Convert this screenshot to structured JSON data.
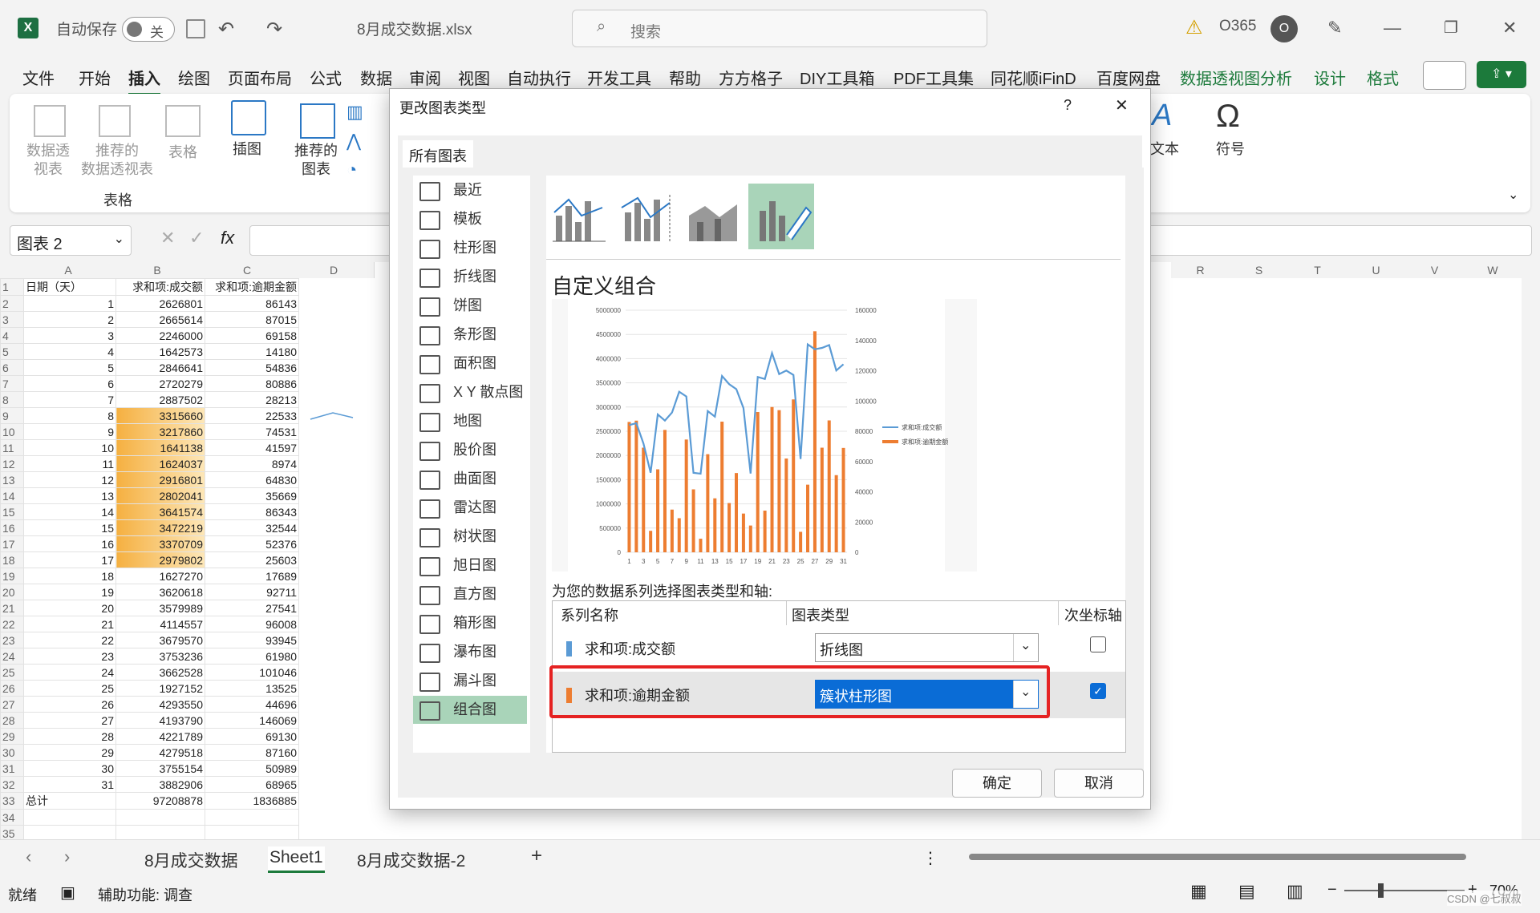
{
  "titlebar": {
    "autosave": "自动保存",
    "toggle": "关",
    "filename": "8月成交数据.xlsx",
    "search": "搜索",
    "account": "O365",
    "avatar": "O"
  },
  "menu": [
    "文件",
    "开始",
    "插入",
    "绘图",
    "页面布局",
    "公式",
    "数据",
    "审阅",
    "视图",
    "自动执行",
    "开发工具",
    "帮助",
    "方方格子",
    "DIY工具箱",
    "PDF工具集",
    "同花顺iFinD",
    "百度网盘",
    "数据透视图分析",
    "设计",
    "格式"
  ],
  "ribbon": {
    "pivot": "数据透\n视表",
    "rec_pivot": "推荐的\n数据透视表",
    "table": "表格",
    "group_table": "表格",
    "illustrations": "插图",
    "rec_charts": "推荐的\n图表",
    "text": "文本",
    "symbol": "符号"
  },
  "formula": {
    "namebox": "图表 2",
    "fx": "fx"
  },
  "sheet": {
    "cols_left": [
      "A",
      "B",
      "C",
      "D"
    ],
    "cols_right": [
      "R",
      "S",
      "T",
      "U",
      "V",
      "W"
    ],
    "header": [
      "日期（天）",
      "求和项:成交额",
      "求和项:逾期金额"
    ],
    "rows": [
      [
        1,
        2626801,
        86143
      ],
      [
        2,
        2665614,
        87015
      ],
      [
        3,
        2246000,
        69158
      ],
      [
        4,
        1642573,
        14180
      ],
      [
        5,
        2846641,
        54836
      ],
      [
        6,
        2720279,
        80886
      ],
      [
        7,
        2887502,
        28213
      ],
      [
        8,
        3315660,
        22533
      ],
      [
        9,
        3217860,
        74531
      ],
      [
        10,
        1641138,
        41597
      ],
      [
        11,
        1624037,
        8974
      ],
      [
        12,
        2916801,
        64830
      ],
      [
        13,
        2802041,
        35669
      ],
      [
        14,
        3641574,
        86343
      ],
      [
        15,
        3472219,
        32544
      ],
      [
        16,
        3370709,
        52376
      ],
      [
        17,
        2979802,
        25603
      ],
      [
        18,
        1627270,
        17689
      ],
      [
        19,
        3620618,
        92711
      ],
      [
        20,
        3579989,
        27541
      ],
      [
        21,
        4114557,
        96008
      ],
      [
        22,
        3679570,
        93945
      ],
      [
        23,
        3753236,
        61980
      ],
      [
        24,
        3662528,
        101046
      ],
      [
        25,
        1927152,
        13525
      ],
      [
        26,
        4293550,
        44696
      ],
      [
        27,
        4193790,
        146069
      ],
      [
        28,
        4221789,
        69130
      ],
      [
        29,
        4279518,
        87160
      ],
      [
        30,
        3755154,
        50989
      ],
      [
        31,
        3882906,
        68965
      ]
    ],
    "total_label": "总计",
    "total_b": "97208878",
    "total_c": "1836885"
  },
  "dialog": {
    "title": "更改图表类型",
    "help": "?",
    "close": "✕",
    "tab": "所有图表",
    "types": [
      "最近",
      "模板",
      "柱形图",
      "折线图",
      "饼图",
      "条形图",
      "面积图",
      "X Y 散点图",
      "地图",
      "股价图",
      "曲面图",
      "雷达图",
      "树状图",
      "旭日图",
      "直方图",
      "箱形图",
      "瀑布图",
      "漏斗图",
      "组合图"
    ],
    "selected_type": "组合图",
    "combo_title": "自定义组合",
    "series_caption": "为您的数据系列选择图表类型和轴:",
    "col_name": "系列名称",
    "col_type": "图表类型",
    "col_axis": "次坐标轴",
    "series": [
      {
        "name": "求和项:成交额",
        "type": "折线图",
        "secondary": false,
        "color": "#5b9bd5"
      },
      {
        "name": "求和项:逾期金额",
        "type": "簇状柱形图",
        "secondary": true,
        "color": "#ed7d31"
      }
    ],
    "ok": "确定",
    "cancel": "取消"
  },
  "chart_data": {
    "type": "bar",
    "x": [
      1,
      2,
      3,
      4,
      5,
      6,
      7,
      8,
      9,
      10,
      11,
      12,
      13,
      14,
      15,
      16,
      17,
      18,
      19,
      20,
      21,
      22,
      23,
      24,
      25,
      26,
      27,
      28,
      29,
      30,
      31
    ],
    "x_ticks": [
      "1",
      "3",
      "5",
      "7",
      "9",
      "11",
      "13",
      "15",
      "17",
      "19",
      "21",
      "23",
      "25",
      "27",
      "29",
      "31"
    ],
    "y_ticks_left": [
      "0",
      "500000",
      "1000000",
      "1500000",
      "2000000",
      "2500000",
      "3000000",
      "3500000",
      "4000000",
      "4500000",
      "5000000"
    ],
    "y_ticks_right": [
      "0",
      "20000",
      "40000",
      "60000",
      "80000",
      "100000",
      "120000",
      "140000",
      "160000"
    ],
    "ylim_left": [
      0,
      5000000
    ],
    "ylim_right": [
      0,
      160000
    ],
    "series": [
      {
        "name": "求和项:成交额",
        "kind": "line",
        "axis": "left",
        "color": "#5b9bd5",
        "values": [
          2626801,
          2665614,
          2246000,
          1642573,
          2846641,
          2720279,
          2887502,
          3315660,
          3217860,
          1641138,
          1624037,
          2916801,
          2802041,
          3641574,
          3472219,
          3370709,
          2979802,
          1627270,
          3620618,
          3579989,
          4114557,
          3679570,
          3753236,
          3662528,
          1927152,
          4293550,
          4193790,
          4221789,
          4279518,
          3755154,
          3882906
        ]
      },
      {
        "name": "求和项:逾期金额",
        "kind": "bar",
        "axis": "right",
        "color": "#ed7d31",
        "values": [
          86143,
          87015,
          69158,
          14180,
          54836,
          80886,
          28213,
          22533,
          74531,
          41597,
          8974,
          64830,
          35669,
          86343,
          32544,
          52376,
          25603,
          17689,
          92711,
          27541,
          96008,
          93945,
          61980,
          101046,
          13525,
          44696,
          146069,
          69130,
          87160,
          50989,
          68965
        ]
      }
    ]
  },
  "tabs": {
    "sheets": [
      "8月成交数据",
      "Sheet1",
      "8月成交数据-2"
    ],
    "active": "Sheet1",
    "add": "+"
  },
  "status": {
    "ready": "就绪",
    "accessibility": "辅助功能: 调查",
    "zoom": "70%",
    "watermark": "CSDN @七叔叔"
  }
}
